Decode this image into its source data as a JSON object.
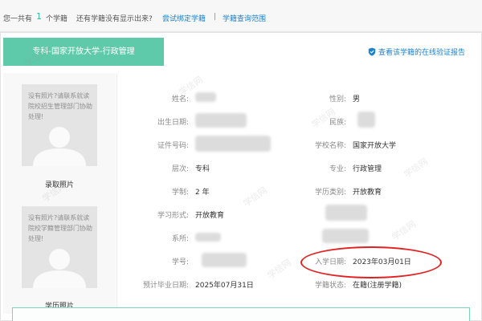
{
  "top": {
    "total_prefix": "您一共有",
    "total_count": "1",
    "total_suffix": "个学籍",
    "missing_question": "还有学籍没有显示出来?",
    "bind_link": "尝试绑定学籍",
    "separator": "|",
    "scope_link": "学籍查询范围"
  },
  "record": {
    "badge": "专科-国家开放大学-行政管理",
    "verify_link": "查看该学籍的在线验证报告",
    "verify_icon": "shield-check-icon"
  },
  "photos": {
    "admission_msg": "没有照片?请联系就读院校招生管理部门协助处理!",
    "admission_caption": "录取照片",
    "education_msg": "没有照片?请联系就读院校学籍管理部门协助处理!",
    "education_caption": "学历照片"
  },
  "fields": {
    "name_label": "姓名:",
    "birth_label": "出生日期:",
    "id_label": "证件号码:",
    "level_label": "层次:",
    "level_value": "专科",
    "duration_label": "学制:",
    "duration_value": "2 年",
    "mode_label": "学习形式:",
    "mode_value": "开放教育",
    "dept_label": "系所:",
    "student_no_label": "学号:",
    "grad_label": "预计毕业日期:",
    "grad_value": "2025年07月31日",
    "gender_label": "性别:",
    "gender_value": "男",
    "ethnic_label": "民族:",
    "school_label": "学校名称:",
    "school_value": "国家开放大学",
    "major_label": "专业:",
    "major_value": "行政管理",
    "category_label": "学历类别:",
    "category_value": "开放教育",
    "enroll_label": "入学日期:",
    "enroll_value": "2023年03月01日",
    "status_label": "学籍状态:",
    "status_value": "在籍(注册学籍)"
  },
  "watermark": "学信网",
  "colors": {
    "accent_green": "#5fcaa9",
    "link_blue": "#1b82d1",
    "highlight_red": "#e32020"
  }
}
